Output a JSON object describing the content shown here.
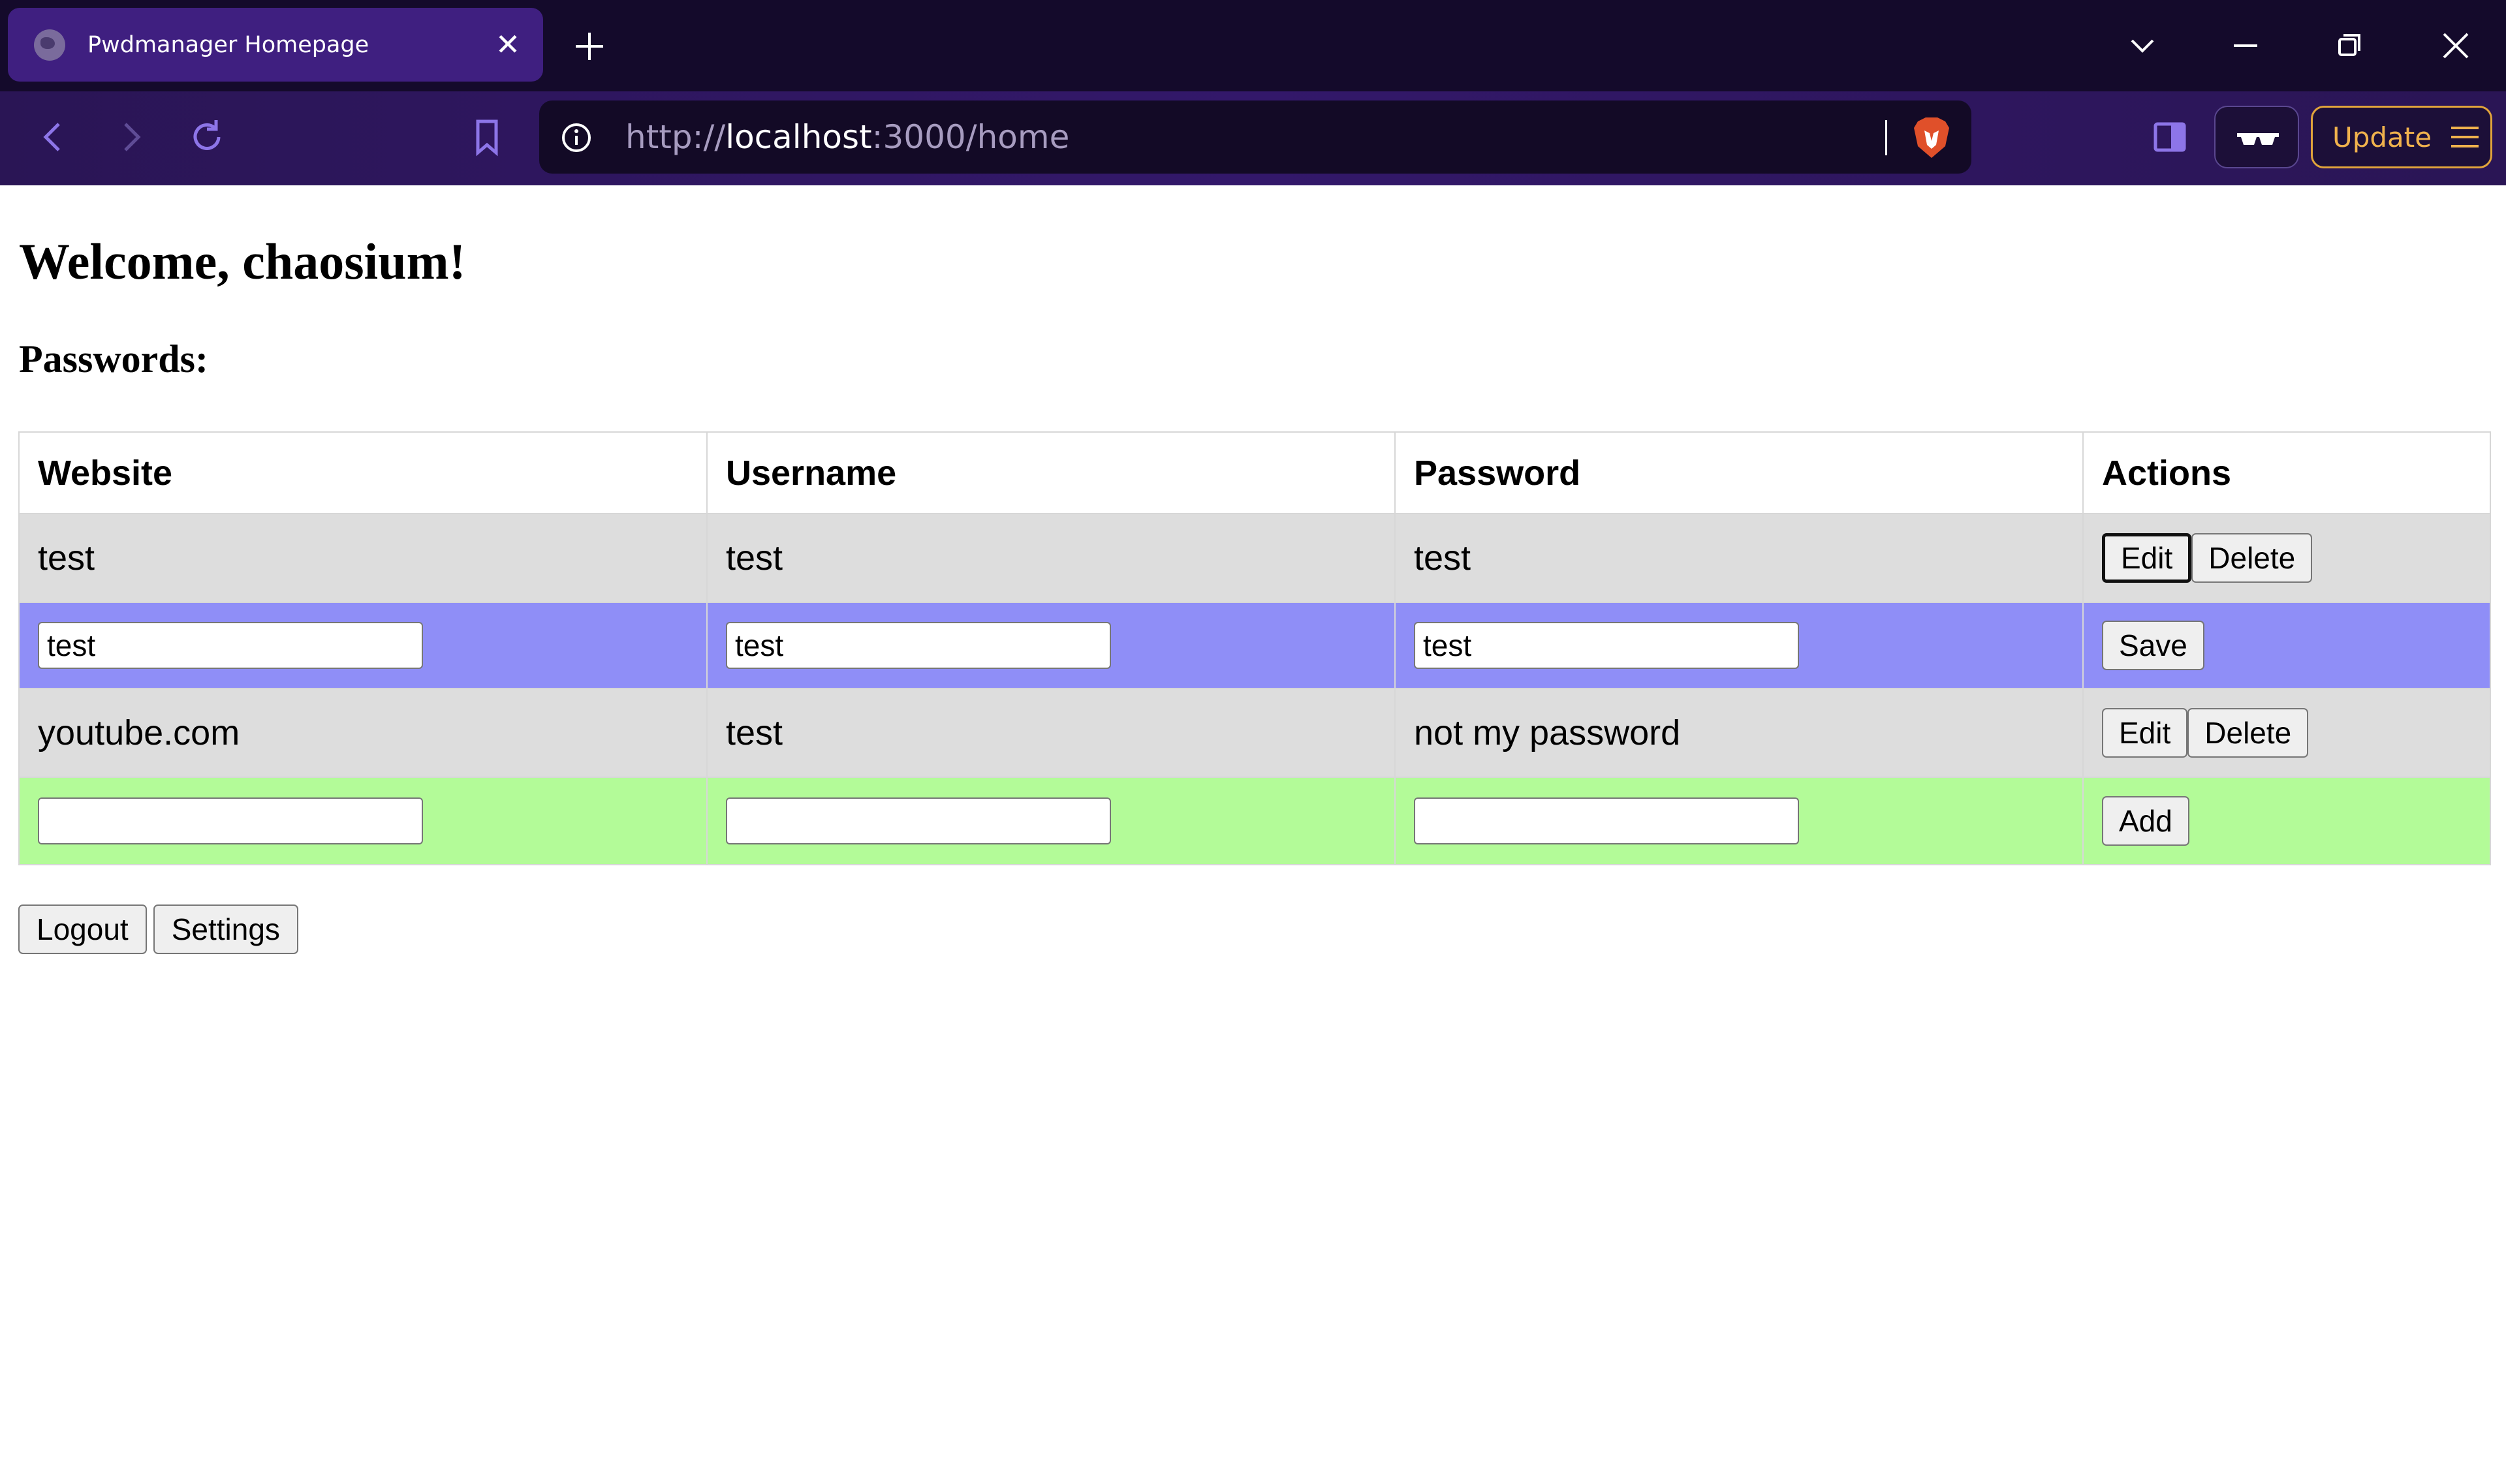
{
  "browser": {
    "tab_title": "Pwdmanager Homepage",
    "url_scheme": "http://",
    "url_host": "localhost",
    "url_path": ":3000/home",
    "update_label": "Update",
    "accent_color": "#3f1f80"
  },
  "page": {
    "welcome": "Welcome, chaosium!",
    "passwords_heading": "Passwords:"
  },
  "table": {
    "headers": [
      "Website",
      "Username",
      "Password",
      "Actions"
    ],
    "rows": [
      {
        "website": "test",
        "username": "test",
        "password": "test"
      },
      {
        "website": "youtube.com",
        "username": "test",
        "password": "not my password"
      }
    ],
    "edit_row": {
      "website": "test",
      "username": "test",
      "password": "test"
    },
    "edit_label": "Edit",
    "delete_label": "Delete",
    "save_label": "Save",
    "add_label": "Add",
    "colors": {
      "view_row": "#dddddd",
      "edit_row": "#8f8ef7",
      "add_row": "#b3fb98"
    }
  },
  "footer": {
    "logout_label": "Logout",
    "settings_label": "Settings"
  }
}
